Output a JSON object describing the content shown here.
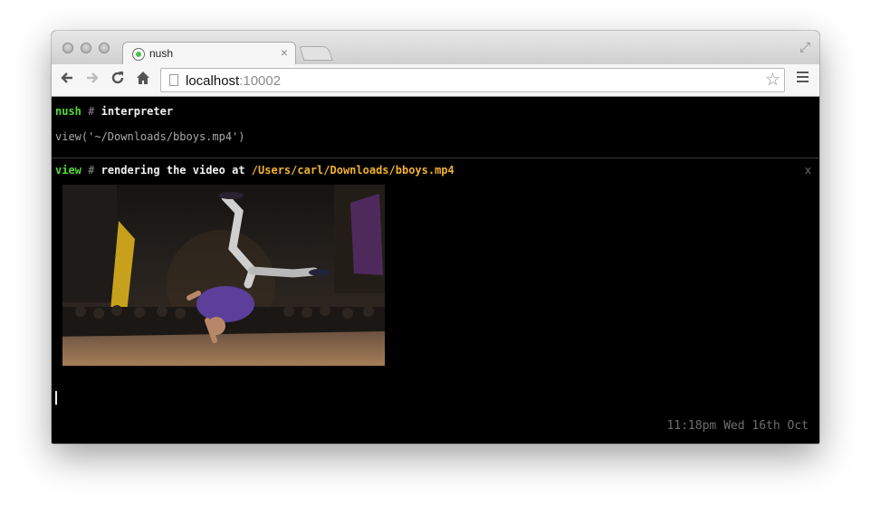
{
  "browser": {
    "tab_title": "nush",
    "tab_close": "×",
    "url_host": "localhost",
    "url_port": ":10002"
  },
  "terminal": {
    "block1": {
      "label": "nush",
      "hash": "#",
      "title": "interpreter",
      "code": "view('~/Downloads/bboys.mp4')"
    },
    "block2": {
      "label": "view",
      "hash": "#",
      "text": "rendering the video at",
      "path": "/Users/carl/Downloads/bboys.mp4",
      "close": "x"
    },
    "timestamp": "11:18pm Wed 16th Oct"
  },
  "colors": {
    "prompt_green": "#56d93a",
    "path_yellow": "#f1b22e",
    "terminal_bg": "#000000"
  },
  "icons": [
    "back-arrow-icon",
    "forward-arrow-icon",
    "reload-icon",
    "home-icon",
    "page-icon",
    "star-icon",
    "menu-icon",
    "fullscreen-icon"
  ]
}
